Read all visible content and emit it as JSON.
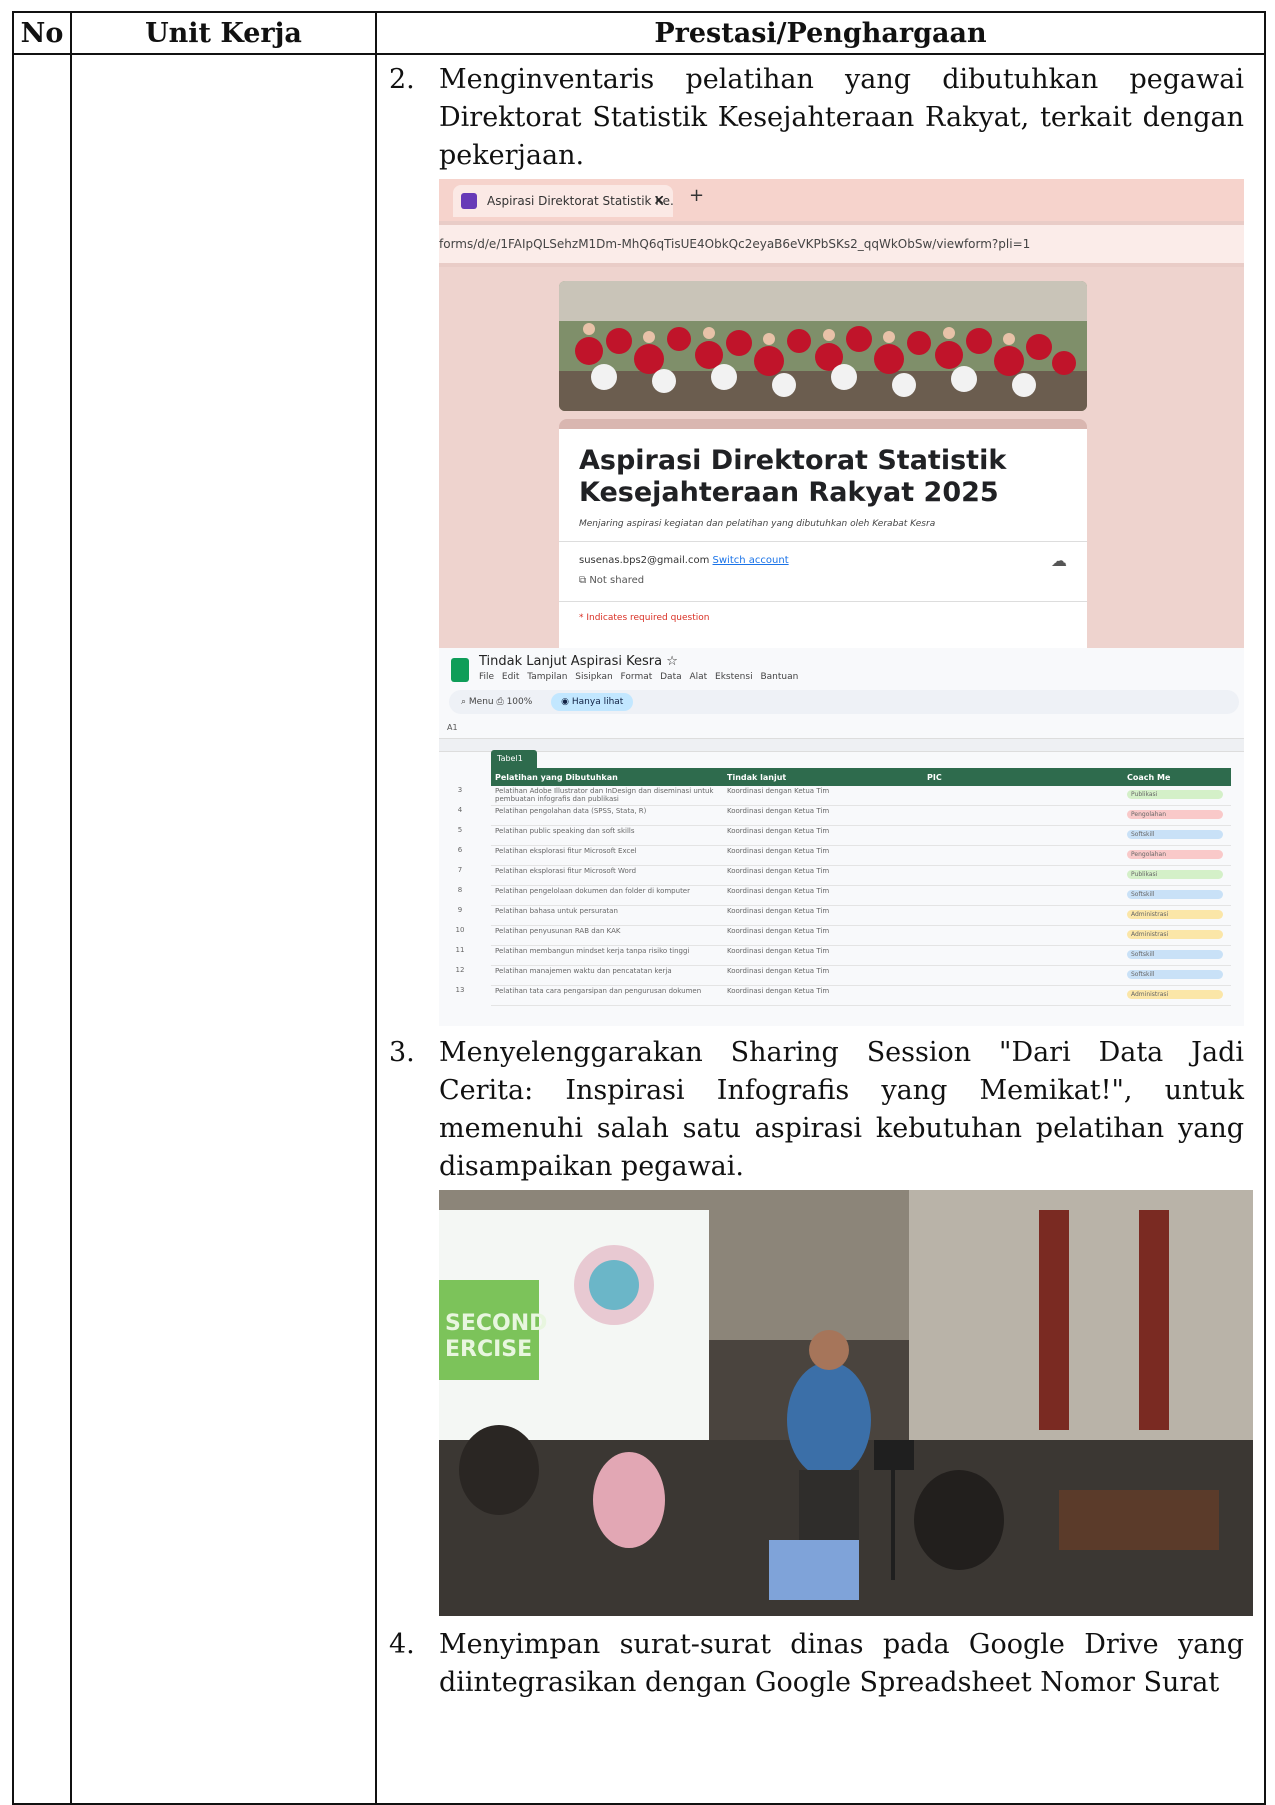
{
  "table": {
    "headers": [
      "No",
      "Unit Kerja",
      "Prestasi/Penghargaan"
    ]
  },
  "items": [
    {
      "num": "2.",
      "text": "Menginventaris pelatihan yang dibutuhkan pegawai Direktorat Statistik Kesejahteraan Rakyat, terkait dengan pekerjaan."
    },
    {
      "num": "3.",
      "text": "Menyelenggarakan Sharing Session \"Dari Data Jadi Cerita: Inspirasi Infografis yang Memikat!\", untuk memenuhi salah satu aspirasi kebutuhan pelatihan yang disampaikan pegawai."
    },
    {
      "num": "4.",
      "text": "Menyimpan surat-surat dinas pada Google Drive yang diintegrasikan dengan Google Spreadsheet Nomor Surat"
    }
  ],
  "forms_shot": {
    "tab_title": "Aspirasi Direktorat Statistik Ke...",
    "url": "forms/d/e/1FAIpQLSehzM1Dm-MhQ6qTisUE4ObkQc2eyaB6eVKPbSKs2_qqWkObSw/viewform?pli=1",
    "form_title": "Aspirasi Direktorat Statistik Kesejahteraan Rakyat 2025",
    "form_subtitle": "Menjaring aspirasi kegiatan dan pelatihan yang dibutuhkan oleh Kerabat Kesra",
    "account": "susenas.bps2@gmail.com",
    "switch_account": "Switch account",
    "not_shared": "Not shared",
    "required_note": "* Indicates required question"
  },
  "sheets_shot": {
    "doc_title": "Tindak Lanjut Aspirasi Kesra",
    "menu": "File Edit Tampilan Sisipkan Format Data Alat Ekstensi Bantuan",
    "search": "Menu",
    "zoom": "100%",
    "view_mode": "Hanya lihat",
    "cell_ref": "A1",
    "table_tab": "Tabel1",
    "columns": [
      "Pelatihan yang Dibutuhkan",
      "Tindak lanjut",
      "PIC",
      "Coach Me"
    ],
    "rows": [
      {
        "n": "3",
        "pel": "Pelatihan Adobe Illustrator dan InDesign dan diseminasi untuk pembuatan infografis dan publikasi",
        "tl": "Koordinasi dengan Ketua Tim",
        "coach": "Publikasi",
        "cls": "green"
      },
      {
        "n": "4",
        "pel": "Pelatihan pengolahan data (SPSS, Stata, R)",
        "tl": "Koordinasi dengan Ketua Tim",
        "coach": "Pengolahan",
        "cls": "red"
      },
      {
        "n": "5",
        "pel": "Pelatihan public speaking dan soft skills",
        "tl": "Koordinasi dengan Ketua Tim",
        "coach": "Softskill",
        "cls": "blue"
      },
      {
        "n": "6",
        "pel": "Pelatihan eksplorasi fitur Microsoft Excel",
        "tl": "Koordinasi dengan Ketua Tim",
        "coach": "Pengolahan",
        "cls": "red"
      },
      {
        "n": "7",
        "pel": "Pelatihan eksplorasi fitur Microsoft Word",
        "tl": "Koordinasi dengan Ketua Tim",
        "coach": "Publikasi",
        "cls": "green"
      },
      {
        "n": "8",
        "pel": "Pelatihan pengelolaan dokumen dan folder di komputer",
        "tl": "Koordinasi dengan Ketua Tim",
        "coach": "Softskill",
        "cls": "blue"
      },
      {
        "n": "9",
        "pel": "Pelatihan bahasa untuk persuratan",
        "tl": "Koordinasi dengan Ketua Tim",
        "coach": "Administrasi",
        "cls": "yellow"
      },
      {
        "n": "10",
        "pel": "Pelatihan penyusunan RAB dan KAK",
        "tl": "Koordinasi dengan Ketua Tim",
        "coach": "Administrasi",
        "cls": "yellow"
      },
      {
        "n": "11",
        "pel": "Pelatihan membangun mindset kerja tanpa risiko tinggi",
        "tl": "Koordinasi dengan Ketua Tim",
        "coach": "Softskill",
        "cls": "blue"
      },
      {
        "n": "12",
        "pel": "Pelatihan manajemen waktu dan pencatatan kerja",
        "tl": "Koordinasi dengan Ketua Tim",
        "coach": "Softskill",
        "cls": "blue"
      },
      {
        "n": "13",
        "pel": "Pelatihan tata cara pengarsipan dan pengurusan dokumen",
        "tl": "Koordinasi dengan Ketua Tim",
        "coach": "Administrasi",
        "cls": "yellow"
      }
    ]
  },
  "photo_slide": {
    "text1": "SECOND",
    "text2": "ERCISE"
  },
  "colors": {
    "sheet_header_green": "#2e6b4d",
    "chip_green": "#d4f0c8",
    "chip_red": "#f9c9c9",
    "chip_blue": "#c9e1f7",
    "chip_yellow": "#fbe6a8"
  }
}
